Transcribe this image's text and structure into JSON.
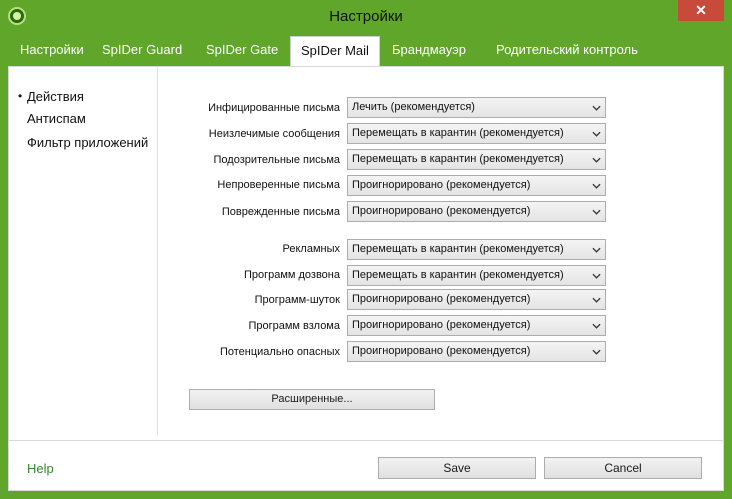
{
  "window": {
    "title": "Настройки",
    "close_label": "✕"
  },
  "tabs": [
    {
      "label": "Настройки"
    },
    {
      "label": "SpIDer Guard"
    },
    {
      "label": "SpIDer Gate"
    },
    {
      "label": "SpIDer Mail"
    },
    {
      "label": "Брандмауэр"
    },
    {
      "label": "Родительский контроль"
    }
  ],
  "active_tab": "SpIDer Mail",
  "sidebar": {
    "bullet": "•",
    "items": [
      {
        "label": "Действия"
      },
      {
        "label": "Антиспам"
      },
      {
        "label": "Фильтр приложений"
      }
    ]
  },
  "actions": [
    {
      "label": "Инфицированные письма",
      "value": "Лечить (рекомендуется)"
    },
    {
      "label": "Неизлечимые сообщения",
      "value": "Перемещать в карантин (рекомендуется)"
    },
    {
      "label": "Подозрительные письма",
      "value": "Перемещать в карантин (рекомендуется)"
    },
    {
      "label": "Непроверенные письма",
      "value": "Проигнорировано (рекомендуется)"
    },
    {
      "label": "Поврежденные письма",
      "value": "Проигнорировано (рекомендуется)"
    },
    {
      "label": "Рекламных",
      "value": "Перемещать в карантин (рекомендуется)"
    },
    {
      "label": "Программ дозвона",
      "value": "Перемещать в карантин (рекомендуется)"
    },
    {
      "label": "Программ-шуток",
      "value": "Проигнорировано (рекомендуется)"
    },
    {
      "label": "Программ взлома",
      "value": "Проигнорировано (рекомендуется)"
    },
    {
      "label": "Потенциально опасных",
      "value": "Проигнорировано (рекомендуется)"
    }
  ],
  "advanced_button": "Расширенные...",
  "footer": {
    "help": "Help",
    "save": "Save",
    "cancel": "Cancel"
  },
  "colors": {
    "accent": "#5fa62b",
    "help_link": "#2f8a2c",
    "close": "#c74a3a"
  },
  "icons": {
    "app": "drweb-spider-icon",
    "dropdown": "chevron-down-icon"
  }
}
